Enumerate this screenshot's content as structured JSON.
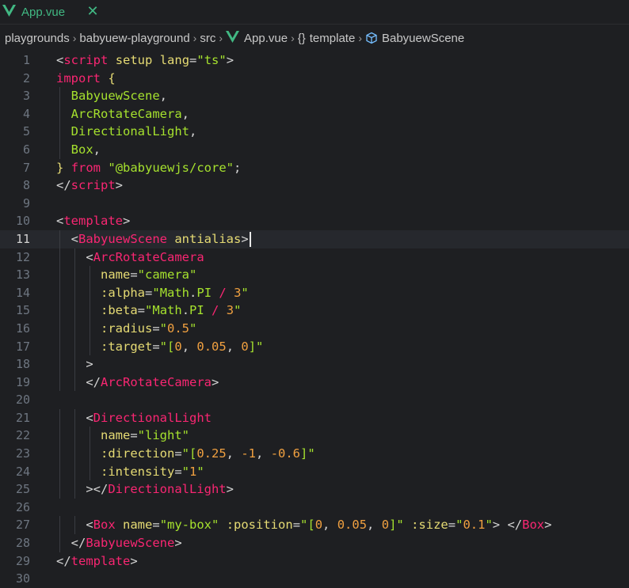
{
  "tab": {
    "label": "App.vue",
    "close_glyph": "✕",
    "icon": "vue-icon"
  },
  "breadcrumb": {
    "items": [
      "playgrounds",
      "babyuew-playground",
      "src",
      "App.vue",
      "template",
      "BabyuewScene"
    ],
    "separator": "›",
    "braces": "{}"
  },
  "colors": {
    "background": "#1e1f22",
    "vue_green": "#41b883",
    "tag": "#f92672",
    "attribute": "#e6db74",
    "string": "#a6e22e",
    "number": "#f0a040"
  },
  "editor": {
    "current_line": 11,
    "lines": [
      {
        "n": "1",
        "tokens": [
          [
            "punc",
            "<"
          ],
          [
            "tag",
            "script"
          ],
          [
            "plain",
            " "
          ],
          [
            "attr",
            "setup"
          ],
          [
            "plain",
            " "
          ],
          [
            "attr",
            "lang"
          ],
          [
            "punc",
            "="
          ],
          [
            "str",
            "\"ts\""
          ],
          [
            "punc",
            ">"
          ]
        ]
      },
      {
        "n": "2",
        "tokens": [
          [
            "kw",
            "import"
          ],
          [
            "plain",
            " "
          ],
          [
            "attr",
            "{"
          ]
        ]
      },
      {
        "n": "3",
        "tokens": [
          [
            "plain",
            "  "
          ],
          [
            "id",
            "BabyuewScene"
          ],
          [
            "punc",
            ","
          ]
        ]
      },
      {
        "n": "4",
        "tokens": [
          [
            "plain",
            "  "
          ],
          [
            "id",
            "ArcRotateCamera"
          ],
          [
            "punc",
            ","
          ]
        ]
      },
      {
        "n": "5",
        "tokens": [
          [
            "plain",
            "  "
          ],
          [
            "id",
            "DirectionalLight"
          ],
          [
            "punc",
            ","
          ]
        ]
      },
      {
        "n": "6",
        "tokens": [
          [
            "plain",
            "  "
          ],
          [
            "id",
            "Box"
          ],
          [
            "punc",
            ","
          ]
        ]
      },
      {
        "n": "7",
        "tokens": [
          [
            "attr",
            "}"
          ],
          [
            "plain",
            " "
          ],
          [
            "kw",
            "from"
          ],
          [
            "plain",
            " "
          ],
          [
            "str",
            "\"@babyuewjs/core\""
          ],
          [
            "punc",
            ";"
          ]
        ]
      },
      {
        "n": "8",
        "tokens": [
          [
            "punc",
            "</"
          ],
          [
            "tag",
            "script"
          ],
          [
            "punc",
            ">"
          ]
        ]
      },
      {
        "n": "9",
        "tokens": []
      },
      {
        "n": "10",
        "tokens": [
          [
            "punc",
            "<"
          ],
          [
            "tag",
            "template"
          ],
          [
            "punc",
            ">"
          ]
        ]
      },
      {
        "n": "11",
        "tokens": [
          [
            "plain",
            "  "
          ],
          [
            "punc",
            "<"
          ],
          [
            "tag",
            "BabyuewScene"
          ],
          [
            "plain",
            " "
          ],
          [
            "attr",
            "antialias"
          ],
          [
            "punc",
            ">"
          ]
        ],
        "cursor": true
      },
      {
        "n": "12",
        "tokens": [
          [
            "plain",
            "    "
          ],
          [
            "punc",
            "<"
          ],
          [
            "tag",
            "ArcRotateCamera"
          ]
        ]
      },
      {
        "n": "13",
        "tokens": [
          [
            "plain",
            "      "
          ],
          [
            "attr",
            "name"
          ],
          [
            "punc",
            "="
          ],
          [
            "str",
            "\"camera\""
          ]
        ]
      },
      {
        "n": "14",
        "tokens": [
          [
            "plain",
            "      "
          ],
          [
            "attr",
            ":alpha"
          ],
          [
            "punc",
            "="
          ],
          [
            "str",
            "\""
          ],
          [
            "id",
            "Math"
          ],
          [
            "punc",
            "."
          ],
          [
            "id",
            "PI"
          ],
          [
            "plain",
            " "
          ],
          [
            "op",
            "/"
          ],
          [
            "plain",
            " "
          ],
          [
            "val",
            "3"
          ],
          [
            "str",
            "\""
          ]
        ]
      },
      {
        "n": "15",
        "tokens": [
          [
            "plain",
            "      "
          ],
          [
            "attr",
            ":beta"
          ],
          [
            "punc",
            "="
          ],
          [
            "str",
            "\""
          ],
          [
            "id",
            "Math"
          ],
          [
            "punc",
            "."
          ],
          [
            "id",
            "PI"
          ],
          [
            "plain",
            " "
          ],
          [
            "op",
            "/"
          ],
          [
            "plain",
            " "
          ],
          [
            "val",
            "3"
          ],
          [
            "str",
            "\""
          ]
        ]
      },
      {
        "n": "16",
        "tokens": [
          [
            "plain",
            "      "
          ],
          [
            "attr",
            ":radius"
          ],
          [
            "punc",
            "="
          ],
          [
            "str",
            "\""
          ],
          [
            "val",
            "0.5"
          ],
          [
            "str",
            "\""
          ]
        ]
      },
      {
        "n": "17",
        "tokens": [
          [
            "plain",
            "      "
          ],
          [
            "attr",
            ":target"
          ],
          [
            "punc",
            "="
          ],
          [
            "str",
            "\"["
          ],
          [
            "val",
            "0"
          ],
          [
            "punc",
            ", "
          ],
          [
            "val",
            "0.05"
          ],
          [
            "punc",
            ", "
          ],
          [
            "val",
            "0"
          ],
          [
            "str",
            "]\""
          ]
        ]
      },
      {
        "n": "18",
        "tokens": [
          [
            "plain",
            "    "
          ],
          [
            "punc",
            ">"
          ]
        ]
      },
      {
        "n": "19",
        "tokens": [
          [
            "plain",
            "    "
          ],
          [
            "punc",
            "</"
          ],
          [
            "tag",
            "ArcRotateCamera"
          ],
          [
            "punc",
            ">"
          ]
        ]
      },
      {
        "n": "20",
        "tokens": []
      },
      {
        "n": "21",
        "tokens": [
          [
            "plain",
            "    "
          ],
          [
            "punc",
            "<"
          ],
          [
            "tag",
            "DirectionalLight"
          ]
        ]
      },
      {
        "n": "22",
        "tokens": [
          [
            "plain",
            "      "
          ],
          [
            "attr",
            "name"
          ],
          [
            "punc",
            "="
          ],
          [
            "str",
            "\"light\""
          ]
        ]
      },
      {
        "n": "23",
        "tokens": [
          [
            "plain",
            "      "
          ],
          [
            "attr",
            ":direction"
          ],
          [
            "punc",
            "="
          ],
          [
            "str",
            "\"["
          ],
          [
            "val",
            "0.25"
          ],
          [
            "punc",
            ", "
          ],
          [
            "val",
            "-1"
          ],
          [
            "punc",
            ", "
          ],
          [
            "val",
            "-0.6"
          ],
          [
            "str",
            "]\""
          ]
        ]
      },
      {
        "n": "24",
        "tokens": [
          [
            "plain",
            "      "
          ],
          [
            "attr",
            ":intensity"
          ],
          [
            "punc",
            "="
          ],
          [
            "str",
            "\""
          ],
          [
            "val",
            "1"
          ],
          [
            "str",
            "\""
          ]
        ]
      },
      {
        "n": "25",
        "tokens": [
          [
            "plain",
            "    "
          ],
          [
            "punc",
            "></"
          ],
          [
            "tag",
            "DirectionalLight"
          ],
          [
            "punc",
            ">"
          ]
        ]
      },
      {
        "n": "26",
        "tokens": []
      },
      {
        "n": "27",
        "tokens": [
          [
            "plain",
            "    "
          ],
          [
            "punc",
            "<"
          ],
          [
            "tag",
            "Box"
          ],
          [
            "plain",
            " "
          ],
          [
            "attr",
            "name"
          ],
          [
            "punc",
            "="
          ],
          [
            "str",
            "\"my-box\""
          ],
          [
            "plain",
            " "
          ],
          [
            "attr",
            ":position"
          ],
          [
            "punc",
            "="
          ],
          [
            "str",
            "\"["
          ],
          [
            "val",
            "0"
          ],
          [
            "punc",
            ", "
          ],
          [
            "val",
            "0.05"
          ],
          [
            "punc",
            ", "
          ],
          [
            "val",
            "0"
          ],
          [
            "str",
            "]\""
          ],
          [
            "plain",
            " "
          ],
          [
            "attr",
            ":size"
          ],
          [
            "punc",
            "="
          ],
          [
            "str",
            "\""
          ],
          [
            "val",
            "0.1"
          ],
          [
            "str",
            "\""
          ],
          [
            "punc",
            ">"
          ],
          [
            "plain",
            " "
          ],
          [
            "punc",
            "</"
          ],
          [
            "tag",
            "Box"
          ],
          [
            "punc",
            ">"
          ]
        ]
      },
      {
        "n": "28",
        "tokens": [
          [
            "plain",
            "  "
          ],
          [
            "punc",
            "</"
          ],
          [
            "tag",
            "BabyuewScene"
          ],
          [
            "punc",
            ">"
          ]
        ]
      },
      {
        "n": "29",
        "tokens": [
          [
            "punc",
            "</"
          ],
          [
            "tag",
            "template"
          ],
          [
            "punc",
            ">"
          ]
        ]
      },
      {
        "n": "30",
        "tokens": []
      }
    ]
  }
}
